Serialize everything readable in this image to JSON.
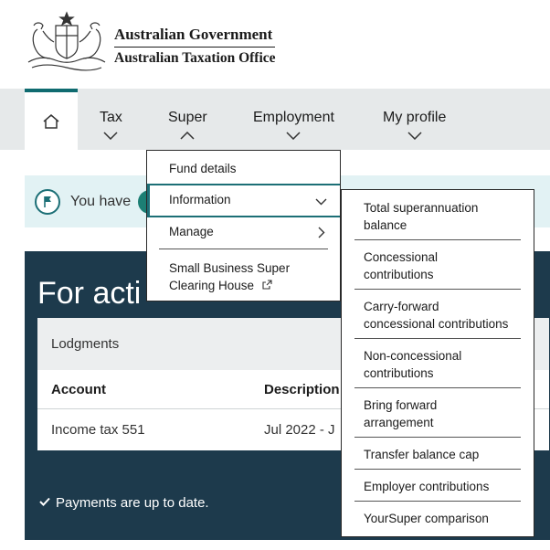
{
  "header": {
    "line1": "Australian Government",
    "line2": "Australian Taxation Office",
    "crest_icon": "coat-of-arms-icon"
  },
  "nav": {
    "home_icon": "home-icon",
    "items": [
      {
        "label": "Tax",
        "chevron": "down"
      },
      {
        "label": "Super",
        "chevron": "up"
      },
      {
        "label": "Employment",
        "chevron": "down"
      },
      {
        "label": "My profile",
        "chevron": "down"
      }
    ]
  },
  "super_menu": {
    "items": [
      {
        "label": "Fund details"
      },
      {
        "label": "Information"
      },
      {
        "label": "Manage"
      },
      {
        "label_line1": "Small Business Super",
        "label_line2": "Clearing House"
      }
    ]
  },
  "information_menu": {
    "items": [
      {
        "line1": "Total superannuation",
        "line2": "balance"
      },
      {
        "line1": "Concessional",
        "line2": "contributions"
      },
      {
        "line1": "Carry-forward",
        "line2": "concessional contributions"
      },
      {
        "line1": "Non-concessional",
        "line2": "contributions"
      },
      {
        "line1": "Bring forward",
        "line2": "arrangement"
      },
      {
        "line1": "Transfer balance cap",
        "line2": ""
      },
      {
        "line1": "Employer contributions",
        "line2": ""
      },
      {
        "line1": "YourSuper comparison",
        "line2": ""
      }
    ]
  },
  "alert": {
    "text": "You have"
  },
  "for_action": {
    "title": "For acti",
    "card_heading": "Lodgments",
    "columns": [
      "Account",
      "Description"
    ],
    "rows": [
      [
        "Income tax 551",
        "Jul 2022 - J"
      ]
    ],
    "status": "Payments are up to date."
  },
  "colors": {
    "accent": "#1c6f76",
    "nav_bg": "#e6e9ea",
    "panel_bg": "#1d3a4c",
    "alert_bg": "#e2f2f4"
  }
}
